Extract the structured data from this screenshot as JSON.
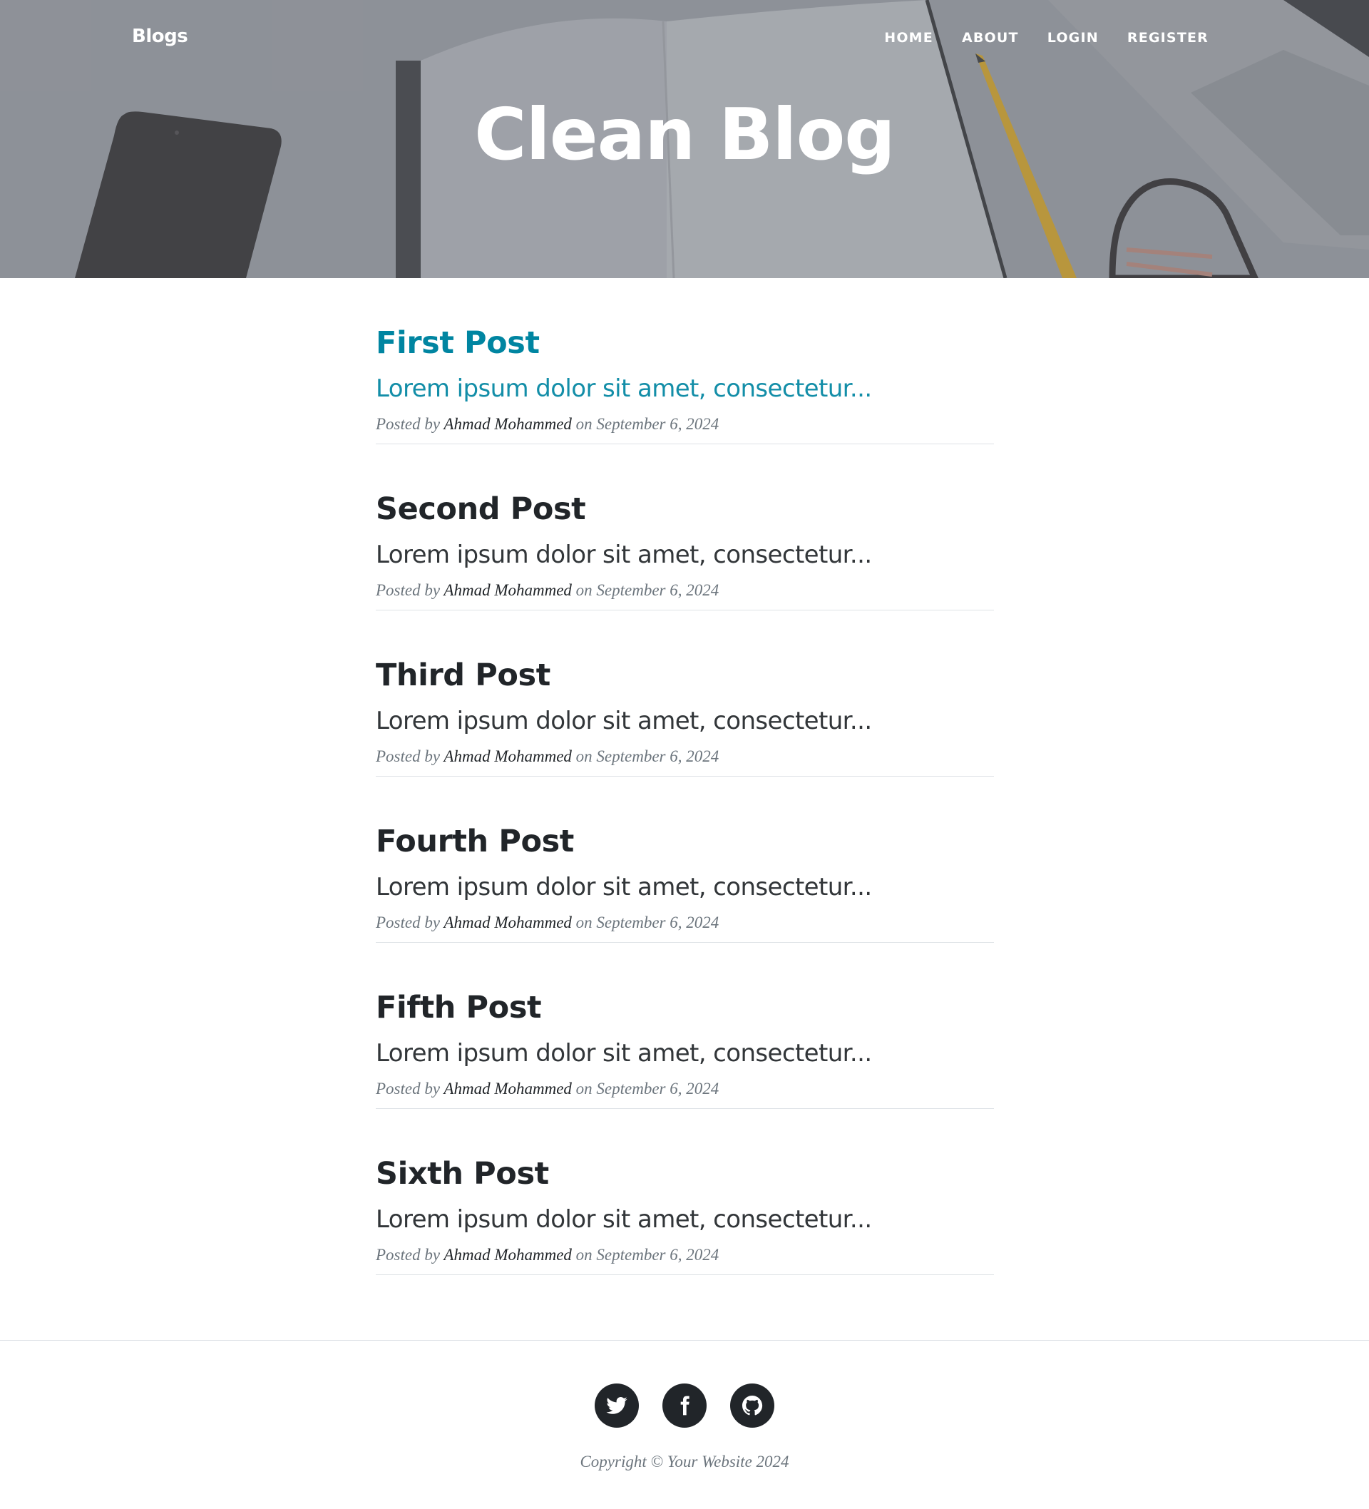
{
  "nav": {
    "brand": "Blogs",
    "links": [
      "HOME",
      "ABOUT",
      "LOGIN",
      "REGISTER"
    ]
  },
  "hero": {
    "title": "Clean Blog"
  },
  "posts": [
    {
      "title": "First Post",
      "subtitle": "Lorem ipsum dolor sit amet, consectetur...",
      "posted_by": "Posted by",
      "author": "Ahmad Mohammed",
      "on": "on",
      "date": "September 6, 2024"
    },
    {
      "title": "Second Post",
      "subtitle": "Lorem ipsum dolor sit amet, consectetur...",
      "posted_by": "Posted by",
      "author": "Ahmad Mohammed",
      "on": "on",
      "date": "September 6, 2024"
    },
    {
      "title": "Third Post",
      "subtitle": "Lorem ipsum dolor sit amet, consectetur...",
      "posted_by": "Posted by",
      "author": "Ahmad Mohammed",
      "on": "on",
      "date": "September 6, 2024"
    },
    {
      "title": "Fourth Post",
      "subtitle": "Lorem ipsum dolor sit amet, consectetur...",
      "posted_by": "Posted by",
      "author": "Ahmad Mohammed",
      "on": "on",
      "date": "September 6, 2024"
    },
    {
      "title": "Fifth Post",
      "subtitle": "Lorem ipsum dolor sit amet, consectetur...",
      "posted_by": "Posted by",
      "author": "Ahmad Mohammed",
      "on": "on",
      "date": "September 6, 2024"
    },
    {
      "title": "Sixth Post",
      "subtitle": "Lorem ipsum dolor sit amet, consectetur...",
      "posted_by": "Posted by",
      "author": "Ahmad Mohammed",
      "on": "on",
      "date": "September 6, 2024"
    }
  ],
  "footer": {
    "social_icons": [
      "twitter-icon",
      "facebook-icon",
      "github-icon"
    ],
    "copyright": "Copyright © Your Website 2024"
  },
  "colors": {
    "accent": "#0085a1",
    "text": "#212529",
    "muted": "#6c757d"
  }
}
